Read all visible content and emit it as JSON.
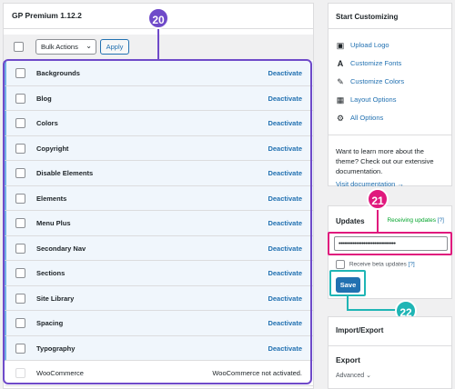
{
  "left_panel": {
    "title": "GP Premium 1.12.2",
    "bulk_actions": {
      "selected": "Bulk Actions",
      "apply": "Apply"
    },
    "modules": [
      {
        "name": "Backgrounds",
        "action": "Deactivate",
        "active": true
      },
      {
        "name": "Blog",
        "action": "Deactivate",
        "active": true
      },
      {
        "name": "Colors",
        "action": "Deactivate",
        "active": true
      },
      {
        "name": "Copyright",
        "action": "Deactivate",
        "active": true
      },
      {
        "name": "Disable Elements",
        "action": "Deactivate",
        "active": true
      },
      {
        "name": "Elements",
        "action": "Deactivate",
        "active": true
      },
      {
        "name": "Menu Plus",
        "action": "Deactivate",
        "active": true
      },
      {
        "name": "Secondary Nav",
        "action": "Deactivate",
        "active": true
      },
      {
        "name": "Sections",
        "action": "Deactivate",
        "active": true
      },
      {
        "name": "Site Library",
        "action": "Deactivate",
        "active": true
      },
      {
        "name": "Spacing",
        "action": "Deactivate",
        "active": true
      },
      {
        "name": "Typography",
        "action": "Deactivate",
        "active": true
      },
      {
        "name": "WooCommerce",
        "action": "WooCommerce not activated.",
        "active": false
      }
    ]
  },
  "start_customizing": {
    "title": "Start Customizing",
    "links": [
      {
        "label": "Upload Logo",
        "icon": "image-icon"
      },
      {
        "label": "Customize Fonts",
        "icon": "font-icon"
      },
      {
        "label": "Customize Colors",
        "icon": "brush-icon"
      },
      {
        "label": "Layout Options",
        "icon": "layout-icon"
      },
      {
        "label": "All Options",
        "icon": "gear-icon"
      }
    ],
    "description": "Want to learn more about the theme? Check out our extensive documentation.",
    "visit_link": "Visit documentation →"
  },
  "updates": {
    "title": "Updates",
    "status": "Receiving updates",
    "help": "[?]",
    "license_value": "••••••••••••••••••••••••••••••••",
    "beta_label": "Receive beta updates",
    "beta_help": "[?]",
    "save": "Save"
  },
  "import_export": {
    "title": "Import/Export",
    "section": "Export",
    "advanced": "Advanced"
  },
  "callouts": {
    "a": "20",
    "b": "21",
    "c": "22"
  },
  "colors": {
    "accent": "#2271b1",
    "purple": "#6f4ac9",
    "pink": "#e0197d",
    "teal": "#1fb5b5",
    "success": "#00a32a"
  }
}
